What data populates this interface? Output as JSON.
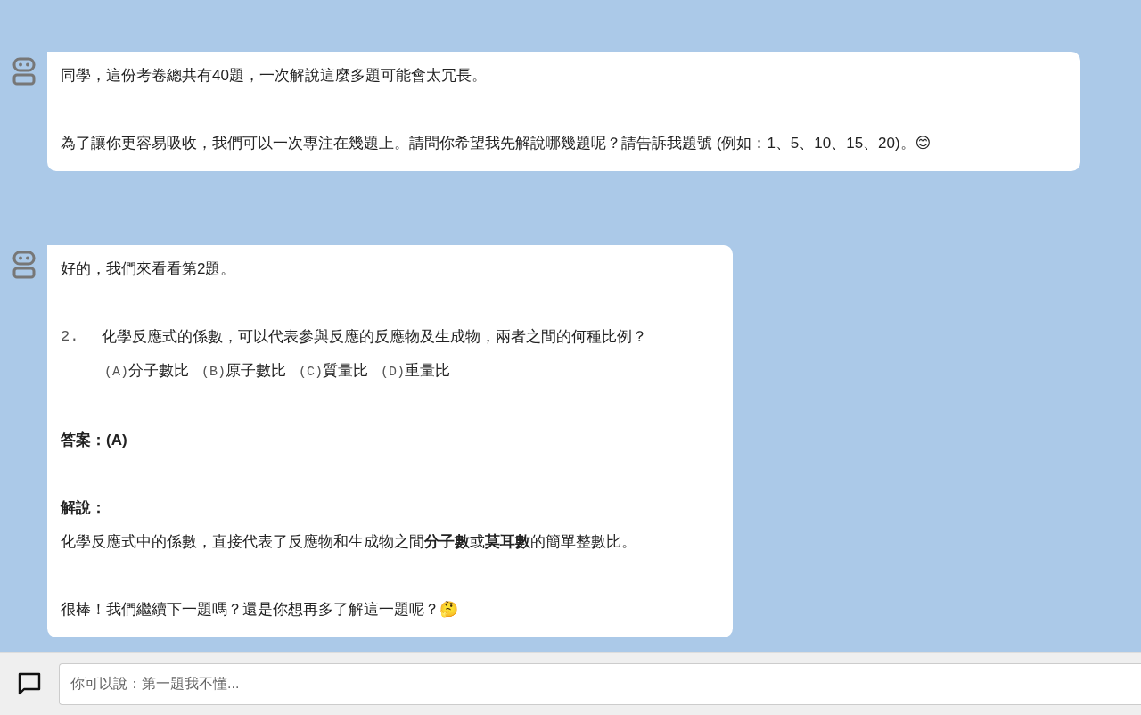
{
  "messages": [
    {
      "kind": "bot",
      "blocks": [
        {
          "kind": "text",
          "lines": [
            "同學，這份考卷總共有40題，一次解說這麼多題可能會太冗長。"
          ]
        },
        {
          "kind": "text",
          "lines": [
            "為了讓你更容易吸收，我們可以一次專注在幾題上。請問你希望我先解說哪幾題呢？請告訴我題號 (例如：1、5、10、15、20)。😊"
          ]
        }
      ]
    },
    {
      "kind": "bot",
      "blocks": [
        {
          "kind": "text",
          "lines": [
            "好的，我們來看看第2題。"
          ]
        },
        {
          "kind": "question",
          "number": "2.",
          "text": "化學反應式的係數，可以代表參與反應的反應物及生成物，兩者之間的何種比例？",
          "options": [
            {
              "letter": "(A)",
              "text": "分子數比"
            },
            {
              "letter": "(B)",
              "text": "原子數比"
            },
            {
              "letter": "(C)",
              "text": "質量比"
            },
            {
              "letter": "(D)",
              "text": "重量比"
            }
          ]
        },
        {
          "kind": "heading",
          "lines": [
            "答案：(A)"
          ]
        },
        {
          "kind": "heading_text",
          "heading": "解說：",
          "lines": [
            "化學反應式中的係數，直接代表了反應物和生成物之間**分子數**或**莫耳數**的簡單整數比。"
          ]
        },
        {
          "kind": "text",
          "lines": [
            "很棒！我們繼續下一題嗎？還是你想再多了解這一題呢？🤔"
          ]
        }
      ]
    }
  ],
  "input": {
    "placeholder": "你可以說：第一題我不懂..."
  }
}
